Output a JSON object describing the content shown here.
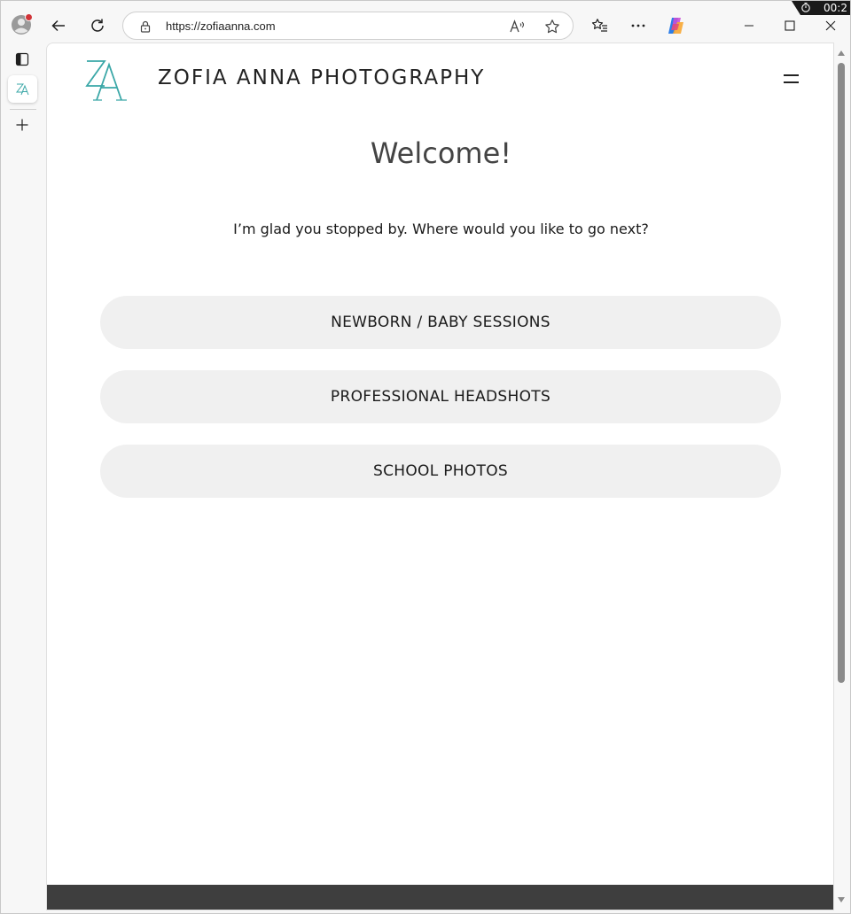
{
  "browser": {
    "url": "https://zofiaanna.com",
    "tray_time": "00:2",
    "tab_favicon_text": "ZA"
  },
  "site": {
    "logo_text": "ZA",
    "title": "ZOFIA ANNA PHOTOGRAPHY",
    "welcome": "Welcome!",
    "intro": "I’m glad you stopped by. Where would you like to go next?",
    "links": [
      {
        "label": "NEWBORN / BABY SESSIONS"
      },
      {
        "label": "PROFESSIONAL HEADSHOTS"
      },
      {
        "label": "SCHOOL PHOTOS"
      }
    ]
  },
  "colors": {
    "brand_teal": "#3aa7a7",
    "button_bg": "#f0f0f0",
    "footer_bg": "#3e3e3e"
  },
  "icons": {
    "profile": "profile-avatar-icon",
    "back": "back-arrow-icon",
    "refresh": "refresh-icon",
    "lock": "lock-icon",
    "read_aloud": "read-aloud-icon",
    "favorite": "star-icon",
    "favorites": "favorites-list-icon",
    "more": "more-icon",
    "copilot": "copilot-icon",
    "minimize": "minimize-icon",
    "maximize": "maximize-icon",
    "close": "close-icon",
    "tab_actions": "tab-actions-icon",
    "new_tab": "plus-icon",
    "menu": "hamburger-menu-icon"
  }
}
